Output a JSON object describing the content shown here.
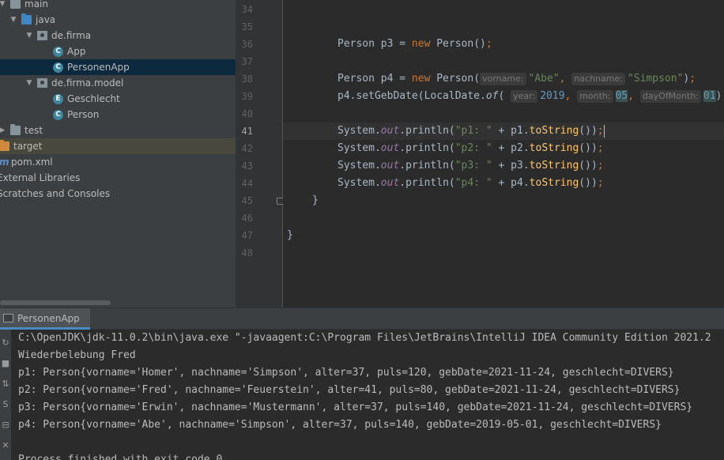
{
  "project_tree": [
    {
      "label": "main",
      "depth": 0,
      "expanded": true,
      "icon": "folder-icon"
    },
    {
      "label": "java",
      "depth": 1,
      "expanded": true,
      "icon": "source-folder-icon"
    },
    {
      "label": "de.firma",
      "depth": 2,
      "expanded": true,
      "icon": "package-icon"
    },
    {
      "label": "App",
      "depth": 3,
      "icon": "class-icon"
    },
    {
      "label": "PersonenApp",
      "depth": 3,
      "icon": "class-icon",
      "selected": true
    },
    {
      "label": "de.firma.model",
      "depth": 2,
      "expanded": true,
      "icon": "package-icon"
    },
    {
      "label": "Geschlecht",
      "depth": 3,
      "icon": "enum-icon"
    },
    {
      "label": "Person",
      "depth": 3,
      "icon": "class-icon"
    },
    {
      "label": "test",
      "depth": 0,
      "expanded": false,
      "icon": "folder-icon"
    },
    {
      "label": "target",
      "depth": 0,
      "icon": "excluded-folder-icon",
      "excluded": true
    },
    {
      "label": "pom.xml",
      "depth": 0,
      "icon": "maven-icon"
    },
    {
      "label": "External Libraries",
      "depth": 0,
      "icon": "library-icon"
    },
    {
      "label": "Scratches and Consoles",
      "depth": 0,
      "icon": "scratches-icon"
    }
  ],
  "editor": {
    "line_numbers": [
      "34",
      "35",
      "36",
      "37",
      "38",
      "39",
      "40",
      "41",
      "42",
      "43",
      "44",
      "45",
      "46",
      "47",
      "48"
    ],
    "active_line": "41",
    "code": {
      "l36": {
        "type": "Person p3 = ",
        "kw": "new",
        "rest": " Person()",
        "semi": ";"
      },
      "l38": {
        "type": "Person p4 = ",
        "kw": "new",
        "call": " Person(",
        "hint1": "vorname:",
        "arg1": "\"Abe\"",
        "comma": ",",
        "hint2": "nachname:",
        "arg2": "\"Simpson\"",
        "end": ")",
        "semi": ";"
      },
      "l39": {
        "pre": "p4.setGebDate(LocalDate.",
        "of": "of",
        "paren": "(",
        "hint1": "year:",
        "arg1": "2019",
        "c1": ",",
        "hint2": "month:",
        "arg2": "05",
        "c2": ",",
        "hint3": "dayOfMonth:",
        "arg3": "01",
        "end": "));"
      },
      "prints": [
        {
          "pre": "System.",
          "out": "out",
          "mid": ".println(",
          "str": "\"p1: \"",
          "plus": " + p1.",
          "mth": "toString",
          "end": "())",
          "semi": ";"
        },
        {
          "pre": "System.",
          "out": "out",
          "mid": ".println(",
          "str": "\"p2: \"",
          "plus": " + p2.",
          "mth": "toString",
          "end": "())",
          "semi": ";"
        },
        {
          "pre": "System.",
          "out": "out",
          "mid": ".println(",
          "str": "\"p3: \"",
          "plus": " + p3.",
          "mth": "toString",
          "end": "())",
          "semi": ";"
        },
        {
          "pre": "System.",
          "out": "out",
          "mid": ".println(",
          "str": "\"p4: \"",
          "plus": " + p4.",
          "mth": "toString",
          "end": "())",
          "semi": ";"
        }
      ],
      "l45": "}",
      "l47": "}"
    }
  },
  "run_panel": {
    "tab_label": "PersonenApp",
    "console_lines": [
      "C:\\OpenJDK\\jdk-11.0.2\\bin\\java.exe \"-javaagent:C:\\Program Files\\JetBrains\\IntelliJ IDEA Community Edition 2021.2",
      "Wiederbelebung Fred",
      "p1: Person{vorname='Homer', nachname='Simpson', alter=37, puls=120, gebDate=2021-11-24, geschlecht=DIVERS}",
      "p2: Person{vorname='Fred', nachname='Feuerstein', alter=41, puls=80, gebDate=2021-11-24, geschlecht=DIVERS}",
      "p3: Person{vorname='Erwin', nachname='Mustermann', alter=37, puls=140, gebDate=2021-11-24, geschlecht=DIVERS}",
      "p4: Person{vorname='Abe', nachname='Simpson', alter=37, puls=140, gebDate=2019-05-01, geschlecht=DIVERS}",
      "",
      "Process finished with exit code 0"
    ],
    "toolbar_icons": [
      "rerun-icon",
      "stop-icon",
      "restore-layout-icon",
      "pin-icon",
      "print-icon",
      "delete-icon"
    ],
    "toolbar_glyphs": [
      "↻",
      "■",
      "⇅",
      "S",
      "⊟",
      "✕"
    ]
  },
  "colors": {
    "keyword": "#cc7832",
    "string": "#6a8759",
    "number": "#6897bb",
    "field": "#9876aa",
    "method": "#ffc66d",
    "selection": "#0d293e"
  }
}
